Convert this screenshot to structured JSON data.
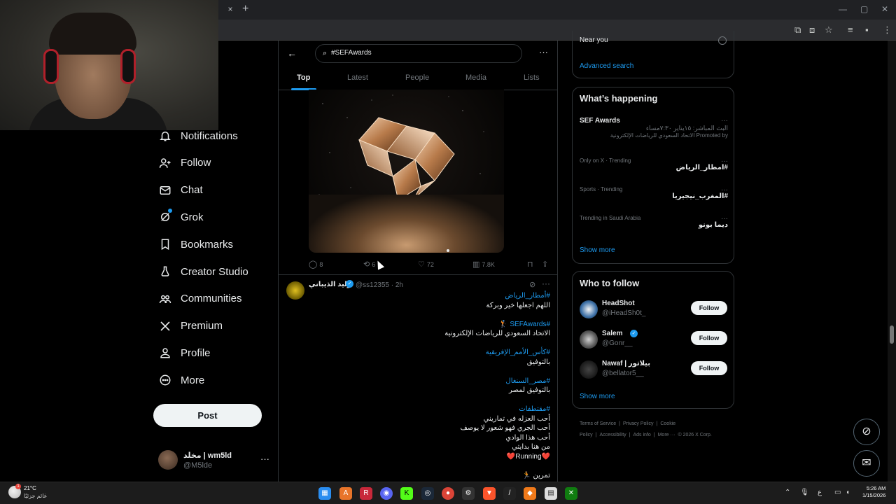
{
  "browser": {
    "tab_close": "×",
    "new_tab": "+",
    "win_min": "—",
    "win_max": "▢",
    "win_close": "✕"
  },
  "nav": {
    "items": [
      {
        "label": "Notifications",
        "icon": "bell-icon"
      },
      {
        "label": "Follow",
        "icon": "follow-icon"
      },
      {
        "label": "Chat",
        "icon": "mail-icon"
      },
      {
        "label": "Grok",
        "icon": "grok-icon"
      },
      {
        "label": "Bookmarks",
        "icon": "bookmark-icon"
      },
      {
        "label": "Creator Studio",
        "icon": "creator-icon"
      },
      {
        "label": "Communities",
        "icon": "communities-icon"
      },
      {
        "label": "Premium",
        "icon": "x-icon"
      },
      {
        "label": "Profile",
        "icon": "person-icon"
      },
      {
        "label": "More",
        "icon": "more-circle-icon"
      }
    ],
    "post_label": "Post",
    "me": {
      "name": "مخلد | wm5ld",
      "handle": "@M5lde"
    }
  },
  "search": {
    "value": "#SEFAwards",
    "tabs": [
      "Top",
      "Latest",
      "People",
      "Media",
      "Lists"
    ],
    "active_tab": "Top"
  },
  "tweet1": {
    "replies": "8",
    "retweets": "6",
    "likes": "72",
    "views": "7.8K"
  },
  "tweet2": {
    "name": "وليد الذيباني",
    "handle": "@ss12355 · 2h",
    "lines": [
      {
        "text": "#أمطار_الرياض",
        "hash": true
      },
      {
        "text": "اللهم اجعلها خير وبركة",
        "hash": false
      },
      {
        "text": "",
        "hash": false
      },
      {
        "text": "#SEFAwards 🏌",
        "hash": true
      },
      {
        "text": "الاتحاد السعودي للرياضات الإلكترونية",
        "hash": false
      },
      {
        "text": "",
        "hash": false
      },
      {
        "text": "#كأس_الأمم_الإفريقية",
        "hash": true
      },
      {
        "text": "بالتوفيق",
        "hash": false
      },
      {
        "text": "",
        "hash": false
      },
      {
        "text": "#مصر_السنغال",
        "hash": true
      },
      {
        "text": "بالتوفيق لمصر",
        "hash": false
      },
      {
        "text": "",
        "hash": false
      },
      {
        "text": "#مقتطفات",
        "hash": true
      },
      {
        "text": "أحب العزله في تماريني",
        "hash": false
      },
      {
        "text": "أحب الجري فهو شعور لا يوصف",
        "hash": false
      },
      {
        "text": "أحب هذا الوادي",
        "hash": false
      },
      {
        "text": "من هنا بدايتي",
        "hash": false
      },
      {
        "text": "❤️Running❤️",
        "hash": false
      },
      {
        "text": "",
        "hash": false
      },
      {
        "text": "تمرين 🏃",
        "hash": false
      }
    ]
  },
  "right": {
    "near_you": "Near you",
    "advanced_search": "Advanced search",
    "whats_happening": "What’s happening",
    "trends": [
      {
        "meta": "",
        "title_ltr": "SEF Awards",
        "sub": "البث المباشر: ١٥يناير ٧:٣٠مساء",
        "promoted": "Promoted by الاتحاد السعودي للرياضات الإلكترونية"
      },
      {
        "meta": "Only on X · Trending",
        "title": "#امطار_الرياض"
      },
      {
        "meta": "Sports · Trending",
        "title": "#المغرب_نيجيريا"
      },
      {
        "meta": "Trending in Saudi Arabia",
        "title": "ديما بونو"
      }
    ],
    "show_more": "Show more",
    "who_to_follow": "Who to follow",
    "follow": [
      {
        "name": "HeadShot",
        "handle": "@iHeadSh0t_",
        "btn": "Follow"
      },
      {
        "name": "Salem",
        "handle": "@Gonr__",
        "btn": "Follow"
      },
      {
        "name": "Nawaf | بيلاتور",
        "handle": "@bellator5__",
        "btn": "Follow"
      }
    ],
    "footer": [
      "Terms of Service",
      "|",
      "Privacy Policy",
      "|",
      "Cookie Policy",
      "|",
      "Accessibility",
      "|",
      "Ads info",
      "|",
      "More ···",
      "© 2026 X Corp."
    ]
  },
  "taskbar": {
    "temp": "21°C",
    "weather": "غائم جزئيًا",
    "badge": "1",
    "lang": "ع",
    "time": "5:26 AM",
    "date": "1/15/2026"
  }
}
